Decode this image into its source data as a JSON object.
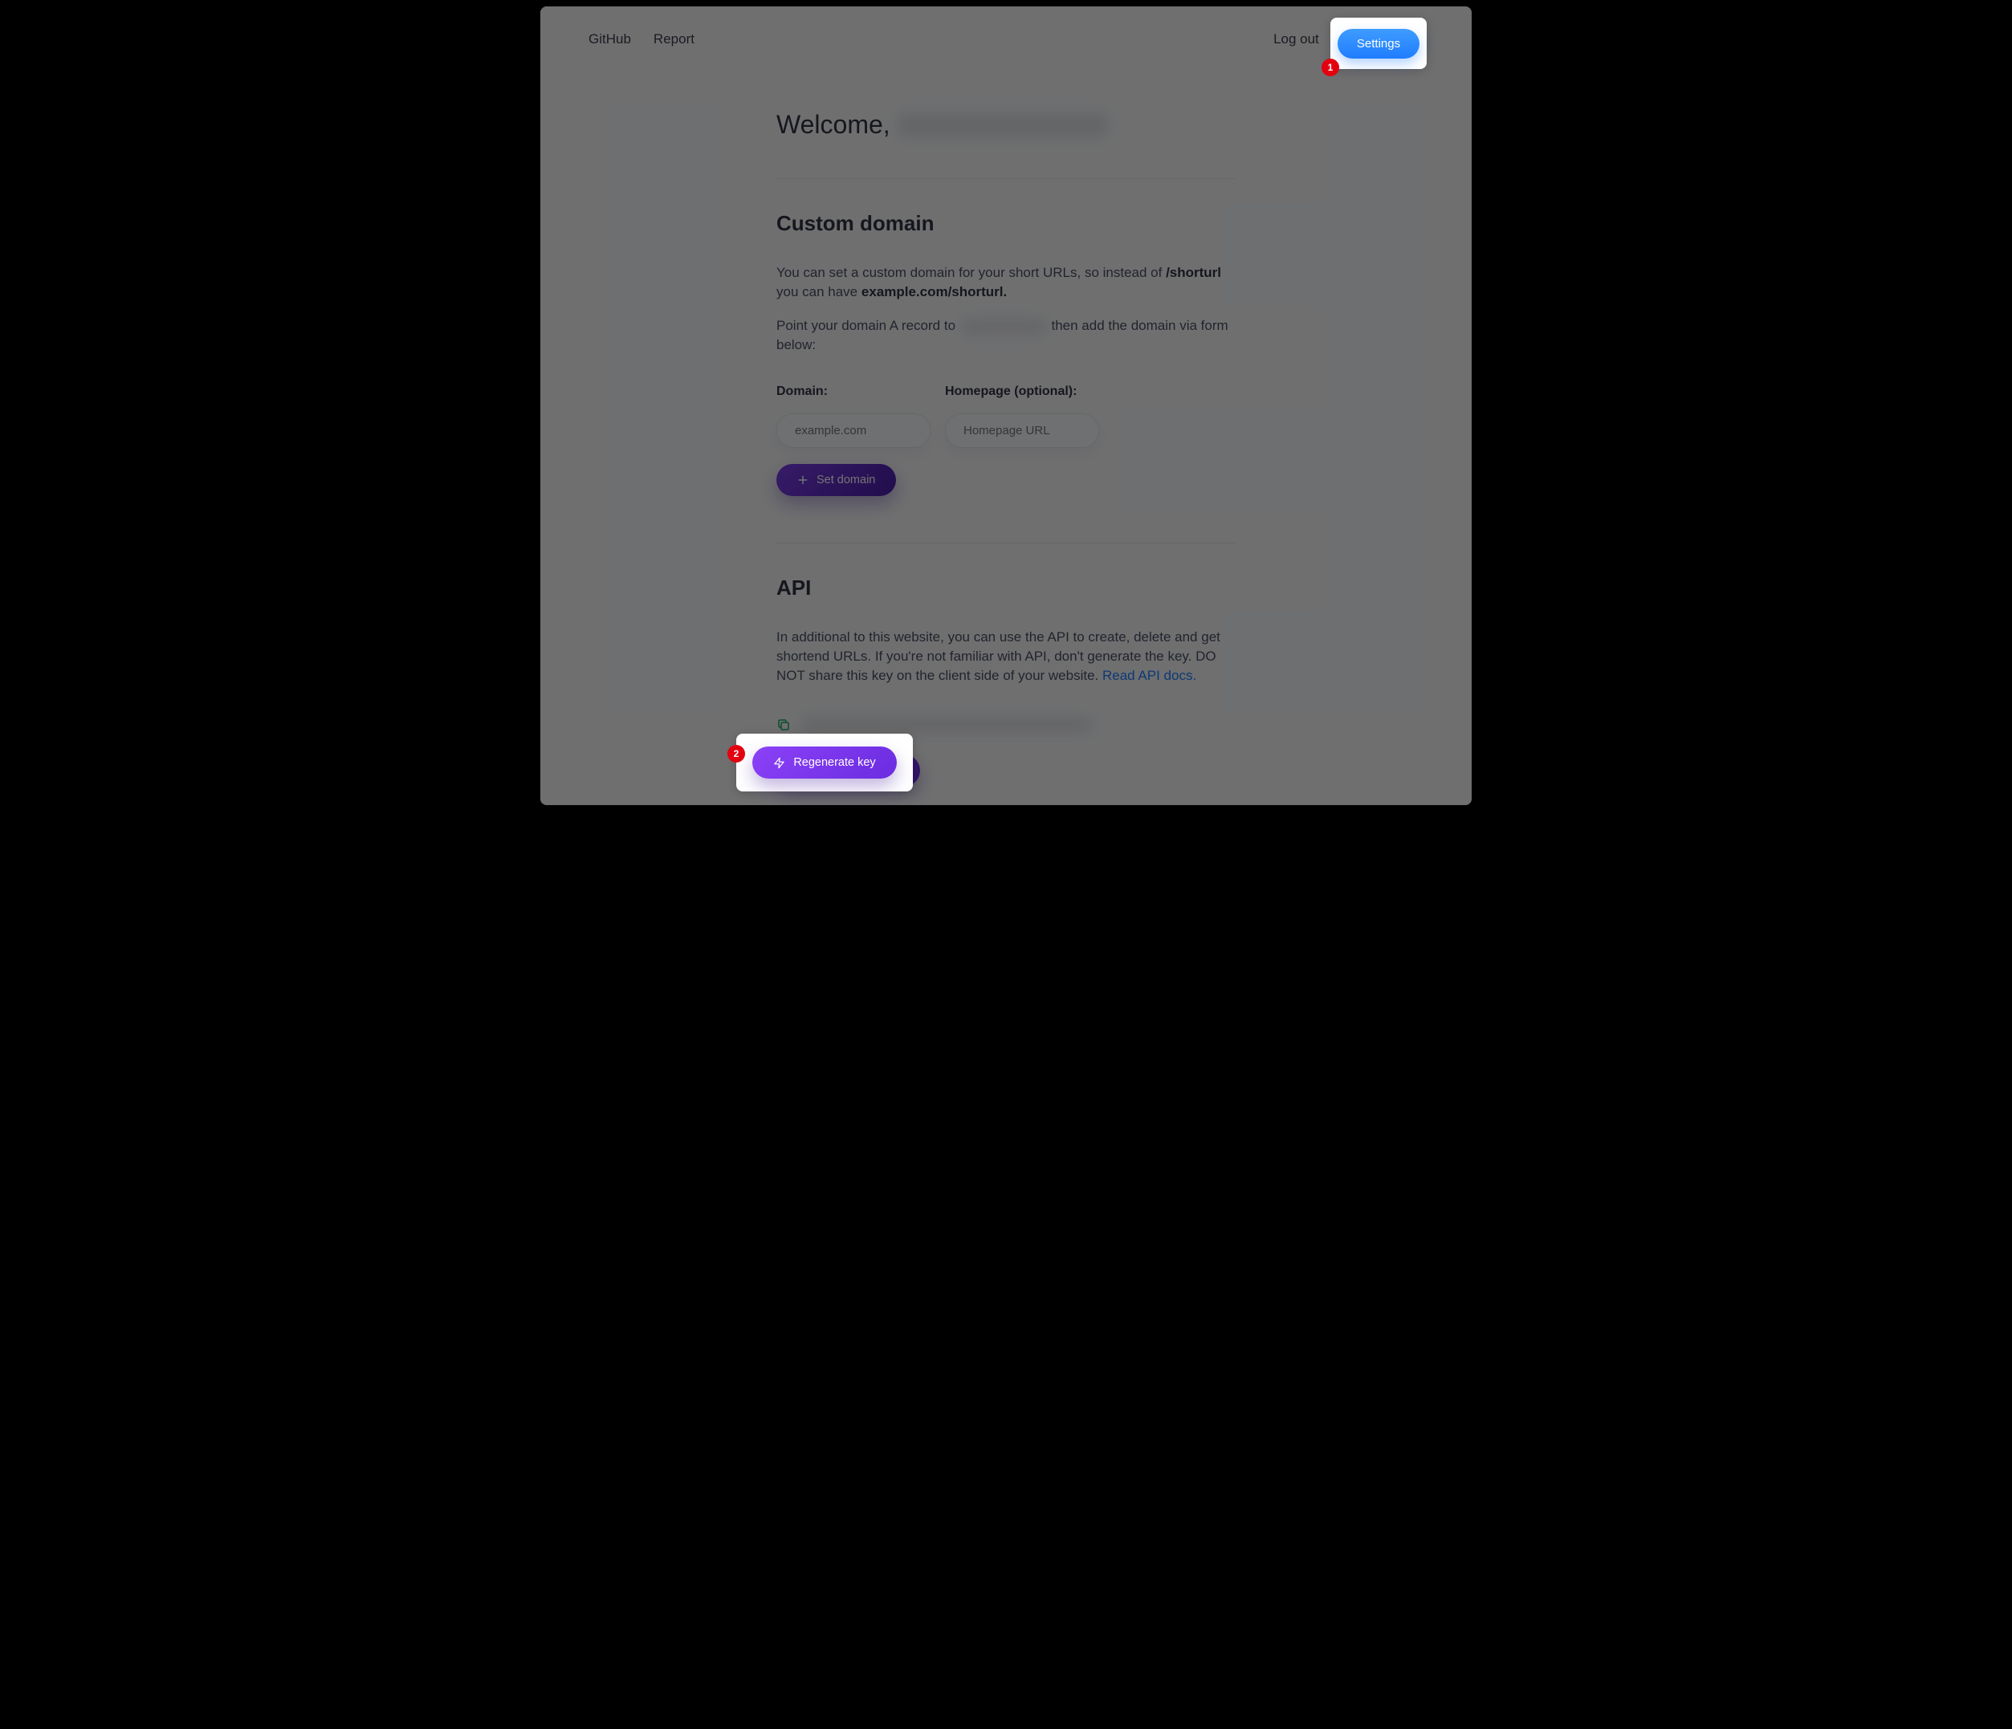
{
  "nav": {
    "github": "GitHub",
    "report": "Report",
    "logout": "Log out",
    "settings": "Settings"
  },
  "welcome_prefix": "Welcome,",
  "custom_domain": {
    "title": "Custom domain",
    "intro_before": "You can set a custom domain for your short URLs, so instead of ",
    "intro_bold1": "/shorturl",
    "intro_mid": " you can have ",
    "intro_bold2": "example.com/shorturl.",
    "point_before": "Point your domain A record to ",
    "point_after": " then add the domain via form below:",
    "domain_label": "Domain:",
    "domain_placeholder": "example.com",
    "homepage_label": "Homepage (optional):",
    "homepage_placeholder": "Homepage URL",
    "set_button": "Set domain"
  },
  "api": {
    "title": "API",
    "desc": "In additional to this website, you can use the API to create, delete and get shortend URLs. If you're not familiar with API, don't generate the key. DO NOT share this key on the client side of your website. ",
    "docs_link": "Read API docs.",
    "regenerate": "Regenerate key"
  },
  "callouts": {
    "one": "1",
    "two": "2"
  }
}
